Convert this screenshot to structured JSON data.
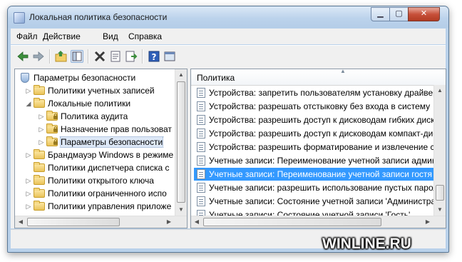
{
  "window": {
    "title": "Локальная политика безопасности"
  },
  "menu": [
    "Файл",
    "Действие",
    "Вид",
    "Справка"
  ],
  "tree": {
    "root": "Параметры безопасности",
    "items": [
      "Политики учетных записей",
      "Локальные политики",
      "Политика аудита",
      "Назначение прав пользоват",
      "Параметры безопасности",
      "Брандмауэр Windows в режиме",
      "Политики диспетчера списка с",
      "Политики открытого ключа",
      "Политики ограниченного испо",
      "Политики управления приложе"
    ]
  },
  "list": {
    "column_header": "Политика",
    "rows": [
      "Устройства: запретить пользователям установку драйверов",
      "Устройства: разрешать отстыковку без входа в систему",
      "Устройства: разрешить доступ к дисководам гибких дисков",
      "Устройства: разрешить доступ к дисководам компакт-дисков",
      "Устройства: разрешить форматирование и извлечение съемных",
      "Учетные записи: Переименование учетной записи админа",
      "Учетные записи: Переименование учетной записи гостя",
      "Учетные записи: разрешить использование пустых паролей",
      "Учетные записи: Состояние учетной записи 'Администратор'",
      "Учетные записи: Состояние учетной записи 'Гость'"
    ],
    "selected_index": 6
  },
  "watermark": "WINLINE.RU",
  "colors": {
    "selection": "#3399ff",
    "frame": "#b9d1ea"
  }
}
